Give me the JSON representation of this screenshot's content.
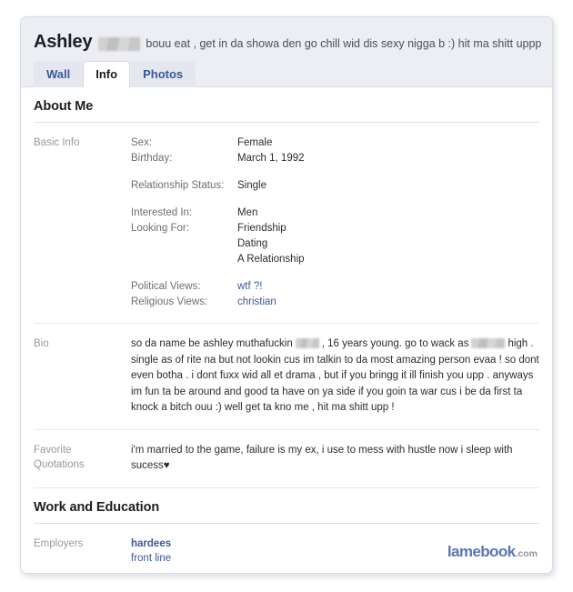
{
  "header": {
    "profile_name": "Ashley",
    "name_redaction": "redacted-last-name",
    "status_text": "bouu eat , get in da showa den go chill wid dis sexy nigga b :) hit ma shitt uppp !"
  },
  "tabs": [
    {
      "label": "Wall",
      "active": false
    },
    {
      "label": "Info",
      "active": true
    },
    {
      "label": "Photos",
      "active": false
    }
  ],
  "sections": {
    "about_me": {
      "title": "About Me",
      "basic_info": {
        "label": "Basic Info",
        "fields": [
          {
            "key": "Sex:",
            "value": "Female"
          },
          {
            "key": "Birthday:",
            "value": "March 1, 1992"
          },
          {
            "key": "Relationship Status:",
            "value": "Single"
          },
          {
            "key": "Interested In:",
            "value": "Men"
          },
          {
            "key": "Looking For:",
            "value": "Friendship"
          },
          {
            "key": "",
            "value": "Dating"
          },
          {
            "key": "",
            "value": "A Relationship"
          },
          {
            "key": "Political Views:",
            "value": "wtf ?!"
          },
          {
            "key": "Religious Views:",
            "value": "christian"
          }
        ]
      },
      "bio": {
        "label": "Bio",
        "text_part_1": "so da name be ashley muthafuckin",
        "text_part_2": ", 16 years young. go to wack as",
        "text_part_3": "high . single as of rite na but not lookin cus im talkin to da most amazing person evaa ! so dont even botha . i dont fuxx wid all et drama , but if you bringg it ill finish you upp . anyways im fun ta be around and good ta have on ya side if you goin ta war cus i be da first ta knock a bitch ouu :) well get ta kno me , hit ma shitt upp !"
      },
      "favorite_quotations": {
        "label_line_1": "Favorite",
        "label_line_2": "Quotations",
        "text": "i'm married to the game, failure is my ex, i use to mess with hustle now i sleep with sucess",
        "heart_glyph": "♥"
      }
    },
    "work_and_education": {
      "title": "Work and Education",
      "employers": {
        "label": "Employers",
        "company": "hardees",
        "position": "front line"
      }
    }
  },
  "watermark": {
    "name": "lamebook",
    "tld": ".com"
  },
  "colors": {
    "link_blue": "#3b5998",
    "header_bg": "#eceef4",
    "label_gray": "#95999f",
    "watermark_blue": "#5a74b4"
  }
}
